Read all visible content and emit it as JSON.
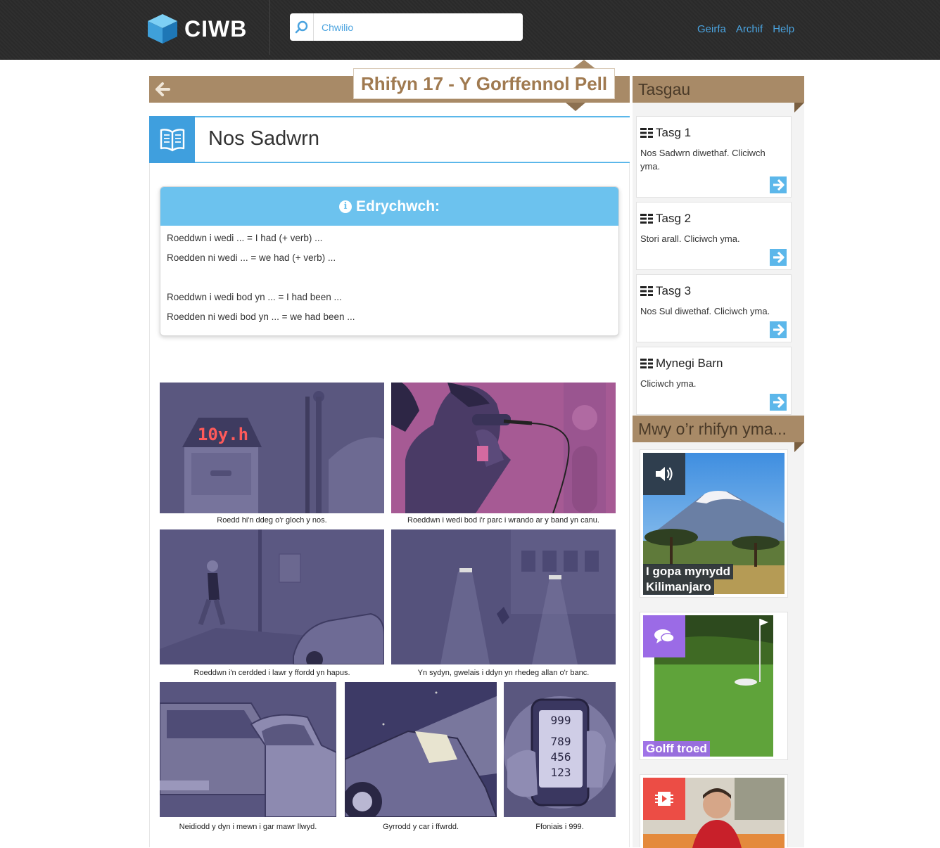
{
  "header": {
    "logo_text": "CIWB",
    "search_placeholder": "Chwilio",
    "nav": [
      "Geirfa",
      "Archif",
      "Help"
    ]
  },
  "issue": {
    "title": "Rhifyn 17 - Y Gorffennol Pell"
  },
  "section": {
    "title": "Nos Sadwrn"
  },
  "callout": {
    "heading": "Edrychwch:",
    "lines": [
      "Roeddwn i wedi ... = I had (+ verb) ...",
      "Roedden ni wedi ... = we had (+ verb) ...",
      "",
      "Roeddwn i wedi bod yn ... = I had been ...",
      "Roedden ni wedi bod yn ... = we had been ..."
    ]
  },
  "comic": {
    "clock_display": "10y.h",
    "phone_keys": [
      "999",
      "789",
      "456",
      "123"
    ],
    "captions": [
      "Roedd hi'n ddeg o'r gloch y nos.",
      "Roeddwn i wedi bod i'r parc i wrando ar y band yn canu.",
      "Roeddwn i'n cerdded i lawr y ffordd yn hapus.",
      "Yn sydyn, gwelais i ddyn yn rhedeg allan o'r banc.",
      "Neidiodd y dyn i mewn i gar mawr llwyd.",
      "Gyrrodd y car i ffwrdd.",
      "Ffoniais i 999."
    ]
  },
  "sidebar": {
    "tasks_heading": "Tasgau",
    "tasks": [
      {
        "title": "Tasg 1",
        "desc": "Nos Sadwrn diwethaf. Cliciwch yma."
      },
      {
        "title": "Tasg 2",
        "desc": "Stori arall. Cliciwch yma."
      },
      {
        "title": "Tasg 3",
        "desc": "Nos Sul diwethaf. Cliciwch yma."
      },
      {
        "title": "Mynegi Barn",
        "desc": "Cliciwch yma."
      }
    ],
    "more_heading": "Mwy o’r rhifyn yma...",
    "cards": [
      {
        "label_line1": "I gopa mynydd",
        "label_line2": "Kilimanjaro",
        "icon": "speaker-icon",
        "color": "#2f3e4e"
      },
      {
        "label_line1": "Golff troed",
        "label_line2": "",
        "icon": "chat-icon",
        "color": "#9b6be6"
      },
      {
        "label_line1": "",
        "label_line2": "",
        "icon": "video-icon",
        "color": "#ec4d45"
      }
    ]
  },
  "colors": {
    "accent_blue": "#3f9fde",
    "brown": "#a88a67",
    "panel_purple": "#5d5a85"
  }
}
